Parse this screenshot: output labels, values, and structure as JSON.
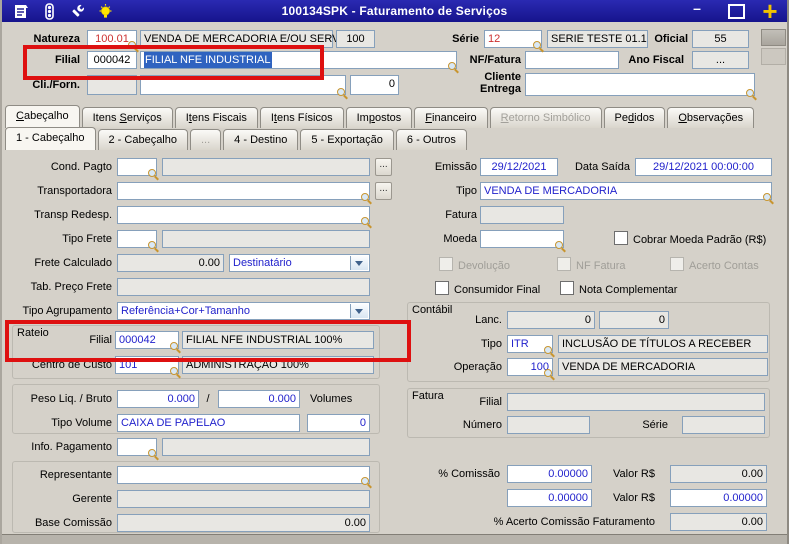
{
  "colors": {
    "titlebar": "#1b1b9e",
    "annotation_box": "#de1010",
    "field_border": "#86a0bb",
    "entry_text_blue": "#2222cc",
    "code_text_red": "#cc3030",
    "selection_blue": "#2f63c0"
  },
  "window": {
    "title": "100134SPK - Faturamento de Serviços",
    "minimize_glyph": "–",
    "close_glyph": "+"
  },
  "header": {
    "natureza_label": "Natureza",
    "natureza_code": "100.01",
    "natureza_desc": "VENDA DE MERCADORIA E/OU SERVI",
    "natureza_num": "100",
    "serie_label": "Série",
    "serie_code": "12",
    "serie_desc": "SERIE TESTE 01.1",
    "oficial_label": "Oficial",
    "oficial_value": "55",
    "filial_label": "Filial",
    "filial_code": "000042",
    "filial_desc": "FILIAL NFE INDUSTRIAL",
    "nf_fatura_label": "NF/Fatura",
    "nf_fatura_value": "",
    "ano_fiscal_label": "Ano Fiscal",
    "ano_fiscal_value": "...",
    "cli_forn_label": "Cli./Forn.",
    "cli_forn_code": "",
    "cli_forn_desc": "",
    "cli_forn_num": "0",
    "cliente_entrega_label1": "Cliente",
    "cliente_entrega_label2": "Entrega",
    "cliente_entrega_value": ""
  },
  "tabs": {
    "main": [
      {
        "label": "Cabeçalho",
        "accel": 0,
        "state": "active"
      },
      {
        "label": "Itens Serviços",
        "accel": 6
      },
      {
        "label": "Itens Fiscais",
        "accel": 1
      },
      {
        "label": "Itens Físicos",
        "accel": 1
      },
      {
        "label": "Impostos",
        "accel": 2
      },
      {
        "label": "Financeiro",
        "accel": 0
      },
      {
        "label": "Retorno Simbólico",
        "accel": 0,
        "state": "disabled"
      },
      {
        "label": "Pedidos",
        "accel": 2
      },
      {
        "label": "Observações",
        "accel": 0
      }
    ],
    "sub": [
      {
        "label": "1 - Cabeçalho",
        "state": "active"
      },
      {
        "label": "2 - Cabeçalho"
      },
      {
        "label": "...",
        "state": "disabled"
      },
      {
        "label": "4 - Destino"
      },
      {
        "label": "5 - Exportação"
      },
      {
        "label": "6 - Outros"
      }
    ]
  },
  "left": {
    "cond_pagto_label": "Cond. Pagto",
    "transportadora_label": "Transportadora",
    "transp_redesp_label": "Transp Redesp.",
    "tipo_frete_label": "Tipo Frete",
    "frete_calculado_label": "Frete Calculado",
    "frete_calculado_value": "0.00",
    "frete_tipo": "Destinatário",
    "tab_preco_frete_label": "Tab. Preço Frete",
    "tipo_agrupamento_label": "Tipo Agrupamento",
    "tipo_agrupamento_value": "Referência+Cor+Tamanho",
    "ellipsis": "...",
    "rateio": {
      "legend": "Rateio",
      "filial_label": "Filial",
      "filial_code": "000042",
      "filial_desc": "FILIAL NFE INDUSTRIAL 100%",
      "cc_label": "Centro de Custo",
      "cc_code": "101",
      "cc_desc": "ADMINISTRAÇAO 100%"
    },
    "peso": {
      "label": "Peso Liq. / Bruto",
      "liq": "0.000",
      "sep": "/",
      "bruto": "0.000",
      "volumes_label": "Volumes",
      "tipo_volume_label": "Tipo Volume",
      "tipo_volume": "CAIXA DE PAPELAO",
      "volumes_value": "0"
    },
    "info_pagamento_label": "Info. Pagamento",
    "representante_label": "Representante",
    "gerente_label": "Gerente",
    "base_comissao_label": "Base Comissão",
    "base_comissao_value": "0.00"
  },
  "right": {
    "emissao_label": "Emissão",
    "emissao_value": "29/12/2021",
    "data_saida_label": "Data Saída",
    "data_saida_value": "29/12/2021 00:00:00",
    "tipo_label": "Tipo",
    "tipo_value": "VENDA DE MERCADORIA",
    "fatura_label": "Fatura",
    "fatura_value": "",
    "moeda_label": "Moeda",
    "moeda_value": "",
    "cobrar_moeda_label": "Cobrar Moeda Padrão (R$)",
    "devolucao_label": "Devolução",
    "nf_fatura_label": "NF Fatura",
    "acerto_contas_label": "Acerto Contas",
    "consumidor_final_label": "Consumidor Final",
    "nota_complementar_label": "Nota Complementar",
    "contabil": {
      "legend": "Contábil",
      "lanc_label": "Lanc.",
      "lanc1": "0",
      "lanc2": "0",
      "tipo_label": "Tipo",
      "tipo_code": "ITR",
      "tipo_desc": "INCLUSÃO DE TÍTULOS A RECEBER",
      "operacao_label": "Operação",
      "operacao_code": "100",
      "operacao_desc": "VENDA DE MERCADORIA"
    },
    "fatura_grp": {
      "legend": "Fatura",
      "filial_label": "Filial",
      "filial_value": "",
      "numero_label": "Número",
      "numero_value": "",
      "serie_label": "Série",
      "serie_value": ""
    },
    "comissao": {
      "pct_label": "% Comissão",
      "pct1": "0.00000",
      "valor_label": "Valor R$",
      "valor1": "0.00",
      "pct2": "0.00000",
      "valor2": "0.00000",
      "acerto_label": "% Acerto Comissão Faturamento",
      "acerto_value": "0.00"
    }
  }
}
